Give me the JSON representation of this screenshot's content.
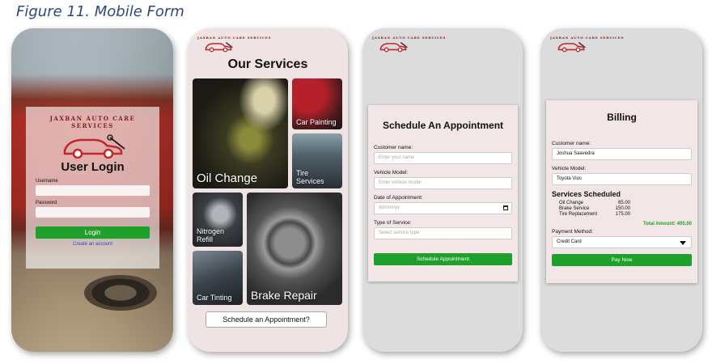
{
  "caption": "Figure 11. Mobile Form",
  "brand": "JAXBAN AUTO CARE SERVICES",
  "login": {
    "title": "User Login",
    "username_label": "Username",
    "password_label": "Password",
    "login_button": "Login",
    "create_account_link": "Create an account"
  },
  "services": {
    "title": "Our Services",
    "tiles": {
      "oil": "Oil Change",
      "paint": "Car Painting",
      "tire": "Tire Services",
      "nitro": "Nitrogen Refill",
      "brake": "Brake Repair",
      "tint": "Car Tinting"
    },
    "schedule_button": "Schedule an Appointment?"
  },
  "appointment": {
    "title": "Schedule An Appointment",
    "name_label": "Customer name:",
    "name_placeholder": "Enter your name",
    "vehicle_label": "Vehicle Model:",
    "vehicle_placeholder": "Enter vehicle model",
    "date_label": "Date of Appointment:",
    "date_placeholder": "dd/mm/yy",
    "service_label": "Type of Service:",
    "service_placeholder": "Select service type",
    "submit_button": "Schedule Appointment"
  },
  "billing": {
    "title": "Billing",
    "name_label": "Customer name:",
    "name_value": "Joshua Saavedra",
    "vehicle_label": "Vehicle Model:",
    "vehicle_value": "Toyota Vios",
    "services_heading": "Services Scheduled",
    "items": [
      {
        "name": "Oil Change",
        "price": "85.00"
      },
      {
        "name": "Brake Service",
        "price": "150.00"
      },
      {
        "name": "Tire Replacement",
        "price": "175.00"
      }
    ],
    "total": "Total Amount: 405.00",
    "payment_label": "Payment Method:",
    "payment_value": "Credit Card",
    "pay_button": "Pay Now"
  },
  "colors": {
    "accent_green": "#1fa02b",
    "card_bg": "#f3e6e6",
    "brand_red": "#7a2020"
  }
}
